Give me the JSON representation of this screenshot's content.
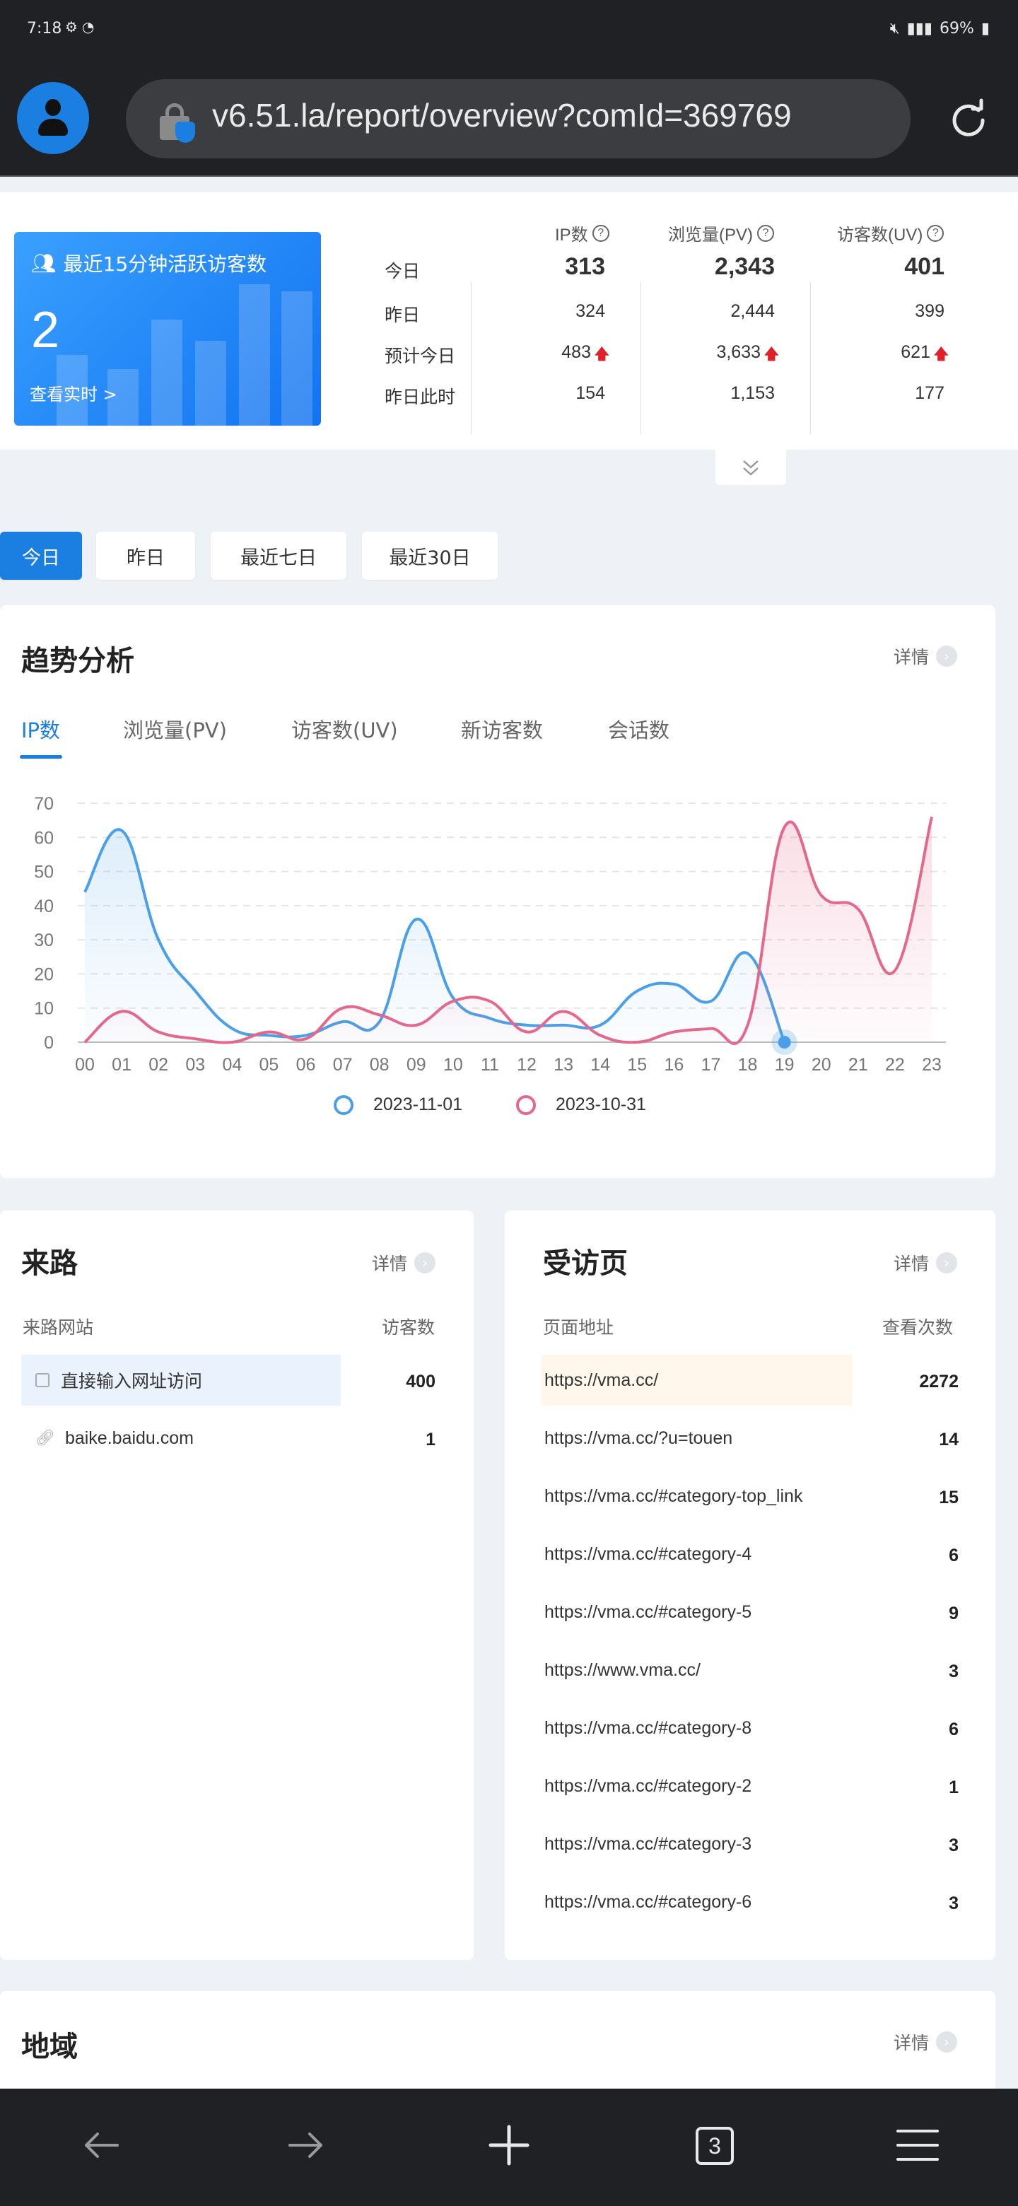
{
  "status_bar": {
    "time": "7:18",
    "battery": "69%"
  },
  "browser": {
    "url": "v6.51.la/report/overview?comId=369769",
    "tab_count": "3"
  },
  "active_visitors": {
    "title": "最近15分钟活跃访客数",
    "count": "2",
    "link": "查看实时 >"
  },
  "stats": {
    "headers": [
      "IP数",
      "浏览量(PV)",
      "访客数(UV)"
    ],
    "rows": [
      {
        "label": "今日",
        "ip": "313",
        "pv": "2,343",
        "uv": "401"
      },
      {
        "label": "昨日",
        "ip": "324",
        "pv": "2,444",
        "uv": "399"
      },
      {
        "label": "预计今日",
        "ip": "483",
        "pv": "3,633",
        "uv": "621"
      },
      {
        "label": "昨日此时",
        "ip": "154",
        "pv": "1,153",
        "uv": "177"
      }
    ]
  },
  "range_tabs": [
    "今日",
    "昨日",
    "最近七日",
    "最近30日"
  ],
  "trend": {
    "title": "趋势分析",
    "detail": "详情",
    "tabs": [
      "IP数",
      "浏览量(PV)",
      "访客数(UV)",
      "新访客数",
      "会话数"
    ]
  },
  "chart_data": {
    "type": "line",
    "x": [
      "00",
      "01",
      "02",
      "03",
      "04",
      "05",
      "06",
      "07",
      "08",
      "09",
      "10",
      "11",
      "12",
      "13",
      "14",
      "15",
      "16",
      "17",
      "18",
      "19",
      "20",
      "21",
      "22",
      "23"
    ],
    "ylim": [
      0,
      70
    ],
    "yticks": [
      0,
      10,
      20,
      30,
      40,
      50,
      60,
      70
    ],
    "series": [
      {
        "name": "2023-11-01",
        "color": "#4a9fea",
        "values": [
          44,
          62,
          30,
          15,
          4,
          2,
          2,
          6,
          6,
          36,
          13,
          7,
          5,
          5,
          5,
          15,
          17,
          12,
          26,
          0
        ]
      },
      {
        "name": "2023-10-31",
        "color": "#e4688c",
        "values": [
          0,
          9,
          3,
          1,
          0,
          3,
          1,
          10,
          8,
          5,
          12,
          12,
          3,
          9,
          2,
          0,
          3,
          4,
          5,
          63,
          43,
          39,
          21,
          66
        ]
      }
    ]
  },
  "sources": {
    "title": "来路",
    "detail": "详情",
    "col1": "来路网站",
    "col2": "访客数",
    "rows": [
      {
        "label": "直接输入网址访问",
        "value": "400"
      },
      {
        "label": "baike.baidu.com",
        "value": "1"
      }
    ]
  },
  "pages": {
    "title": "受访页",
    "detail": "详情",
    "col1": "页面地址",
    "col2": "查看次数",
    "rows": [
      {
        "label": "https://vma.cc/",
        "value": "2272"
      },
      {
        "label": "https://vma.cc/?u=touen",
        "value": "14"
      },
      {
        "label": "https://vma.cc/#category-top_link",
        "value": "15"
      },
      {
        "label": "https://vma.cc/#category-4",
        "value": "6"
      },
      {
        "label": "https://vma.cc/#category-5",
        "value": "9"
      },
      {
        "label": "https://www.vma.cc/",
        "value": "3"
      },
      {
        "label": "https://vma.cc/#category-8",
        "value": "6"
      },
      {
        "label": "https://vma.cc/#category-2",
        "value": "1"
      },
      {
        "label": "https://vma.cc/#category-3",
        "value": "3"
      },
      {
        "label": "https://vma.cc/#category-6",
        "value": "3"
      }
    ]
  },
  "region": {
    "title": "地域",
    "detail": "详情"
  }
}
